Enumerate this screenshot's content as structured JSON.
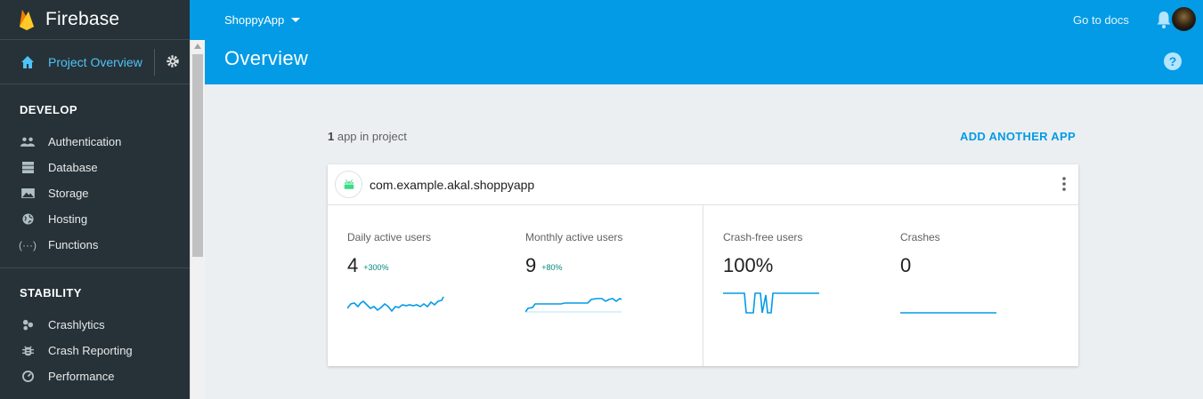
{
  "sidebar": {
    "brand": "Firebase",
    "project_overview": "Project Overview",
    "sections": [
      {
        "title": "DEVELOP",
        "items": [
          {
            "label": "Authentication",
            "icon": "people-icon"
          },
          {
            "label": "Database",
            "icon": "database-icon"
          },
          {
            "label": "Storage",
            "icon": "image-icon"
          },
          {
            "label": "Hosting",
            "icon": "globe-icon"
          },
          {
            "label": "Functions",
            "icon": "functions-icon"
          }
        ]
      },
      {
        "title": "STABILITY",
        "items": [
          {
            "label": "Crashlytics",
            "icon": "crashlytics-icon"
          },
          {
            "label": "Crash Reporting",
            "icon": "bug-icon"
          },
          {
            "label": "Performance",
            "icon": "speedometer-icon"
          }
        ]
      }
    ]
  },
  "header": {
    "project_name": "ShoppyApp",
    "go_to_docs": "Go to docs",
    "title": "Overview"
  },
  "main": {
    "app_count": "1",
    "app_count_suffix": " app in project",
    "add_another_app": "ADD ANOTHER APP",
    "app": {
      "package": "com.example.akal.shoppyapp",
      "metrics": [
        {
          "label": "Daily active users",
          "value": "4",
          "delta": "+300%"
        },
        {
          "label": "Monthly active users",
          "value": "9",
          "delta": "+80%"
        },
        {
          "label": "Crash-free users",
          "value": "100%",
          "delta": ""
        },
        {
          "label": "Crashes",
          "value": "0",
          "delta": ""
        }
      ]
    }
  },
  "colors": {
    "sidebar_bg": "#263238",
    "header_bg": "#039be5",
    "accent": "#039be5",
    "delta_green": "#00897b",
    "android_green": "#3ddc84"
  }
}
